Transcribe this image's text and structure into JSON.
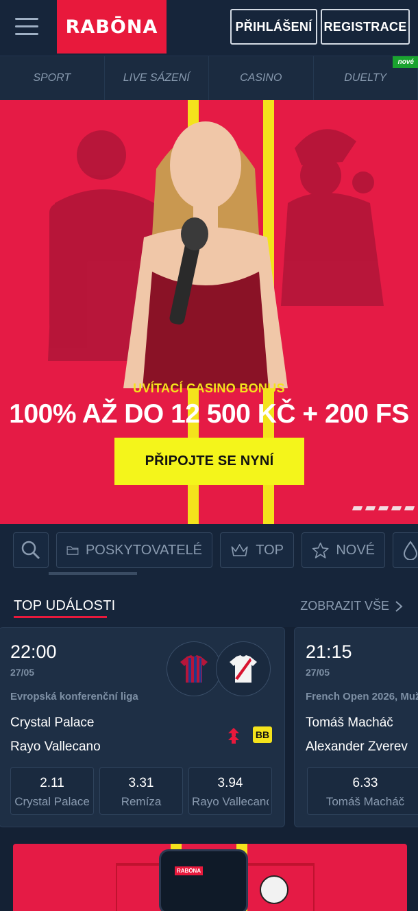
{
  "header": {
    "logo": "RABŌNA",
    "login_label": "PŘIHLÁŠENÍ",
    "register_label": "REGISTRACE"
  },
  "nav": {
    "items": [
      "SPORT",
      "LIVE SÁZENÍ",
      "CASINO",
      "DUELTY"
    ],
    "new_badge": "nové"
  },
  "hero": {
    "subtitle": "UVÍTACÍ CASINO BONUS",
    "title": "100% AŽ DO 12 500 KČ + 200 FS",
    "cta_label": "PŘIPOJTE SE NYNÍ",
    "slides_count": 5
  },
  "categories": {
    "providers_label": "POSKYTOVATELÉ",
    "top_label": "TOP",
    "new_label": "NOVÉ"
  },
  "events": {
    "title": "TOP UDÁLOSTI",
    "see_all_label": "ZOBRAZIT VŠE",
    "cards": [
      {
        "time": "22:00",
        "date": "27/05",
        "league": "Evropská konferenční liga",
        "team1": "Crystal Palace",
        "team2": "Rayo Vallecano",
        "badge": "BB",
        "odds": [
          {
            "value": "2.11",
            "label": "Crystal Palace"
          },
          {
            "value": "3.31",
            "label": "Remíza"
          },
          {
            "value": "3.94",
            "label": "Rayo Vallecano"
          }
        ]
      },
      {
        "time": "21:15",
        "date": "27/05",
        "league": "French Open 2026, Muž",
        "team1": "Tomáš Macháč",
        "team2": "Alexander Zverev",
        "odds": [
          {
            "value": "6.33",
            "label": "Tomáš Macháč"
          }
        ]
      }
    ]
  },
  "promo2": {
    "phone_logo": "RABŌNA"
  },
  "colors": {
    "brand_red": "#e8193c",
    "brand_yellow": "#f4e31c",
    "background": "#142134"
  }
}
